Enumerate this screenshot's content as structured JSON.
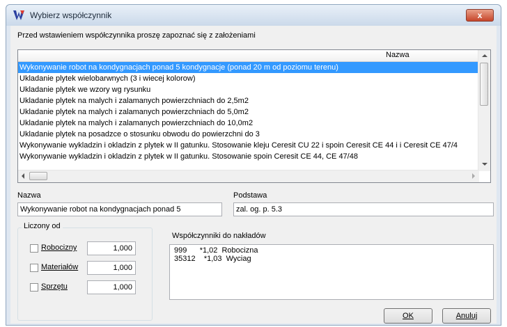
{
  "window": {
    "title": "Wybierz współczynnik",
    "close_label": "x"
  },
  "intro_text": "Przed wstawieniem współczynnika proszę zapoznać się z założeniami",
  "list": {
    "header": "Nazwa",
    "rows": [
      "Wykonywanie robot na kondygnacjach ponad 5 kondygnacje (ponad 20 m od poziomu terenu)",
      "Ukladanie plytek wielobarwnych (3 i wiecej kolorow)",
      "Ukladanie plytek we wzory wg rysunku",
      "Ukladanie plytek na malych i zalamanych powierzchniach do 2,5m2",
      "Ukladanie plytek na malych i zalamanych powierzchniach do 5,0m2",
      "Ukladanie plytek na malych i zalamanych powierzchniach do 10,0m2",
      "Ukladanie plytek na posadzce o stosunku obwodu do powierzchni do 3",
      "Wykonywanie wykladzin i okladzin z plytek w II gatunku. Stosowanie kleju Ceresit CU 22 i spoin Ceresit CE 44 i i Ceresit CE 47/4",
      "Wykonywanie wykladzin i okladzin z plytek w II gatunku. Stosowanie spoin Ceresit CE 44, CE 47/48"
    ],
    "selected_index": 0
  },
  "form": {
    "nazwa_label": "Nazwa",
    "nazwa_value": "Wykonywanie robot na kondygnacjach ponad 5",
    "podstawa_label": "Podstawa",
    "podstawa_value": "zal. og. p. 5.3"
  },
  "liczony_od": {
    "title": "Liczony od",
    "items": [
      {
        "label": "Robocizny",
        "value": "1,000",
        "checked": false
      },
      {
        "label": "Materiałów",
        "value": "1,000",
        "checked": false
      },
      {
        "label": "Sprzętu",
        "value": "1,000",
        "checked": false
      }
    ]
  },
  "wspolczynniki": {
    "label": "Współczynniki do nakładów",
    "lines": [
      "999      *1,02  Robocizna",
      "35312    *1,03  Wyciag"
    ]
  },
  "buttons": {
    "ok": "OK",
    "cancel": "Anuluj"
  },
  "colors": {
    "selection": "#3399ff",
    "close_button": "#c6452a"
  },
  "icons": {
    "app": "app-logo-icon",
    "close": "close-icon"
  }
}
